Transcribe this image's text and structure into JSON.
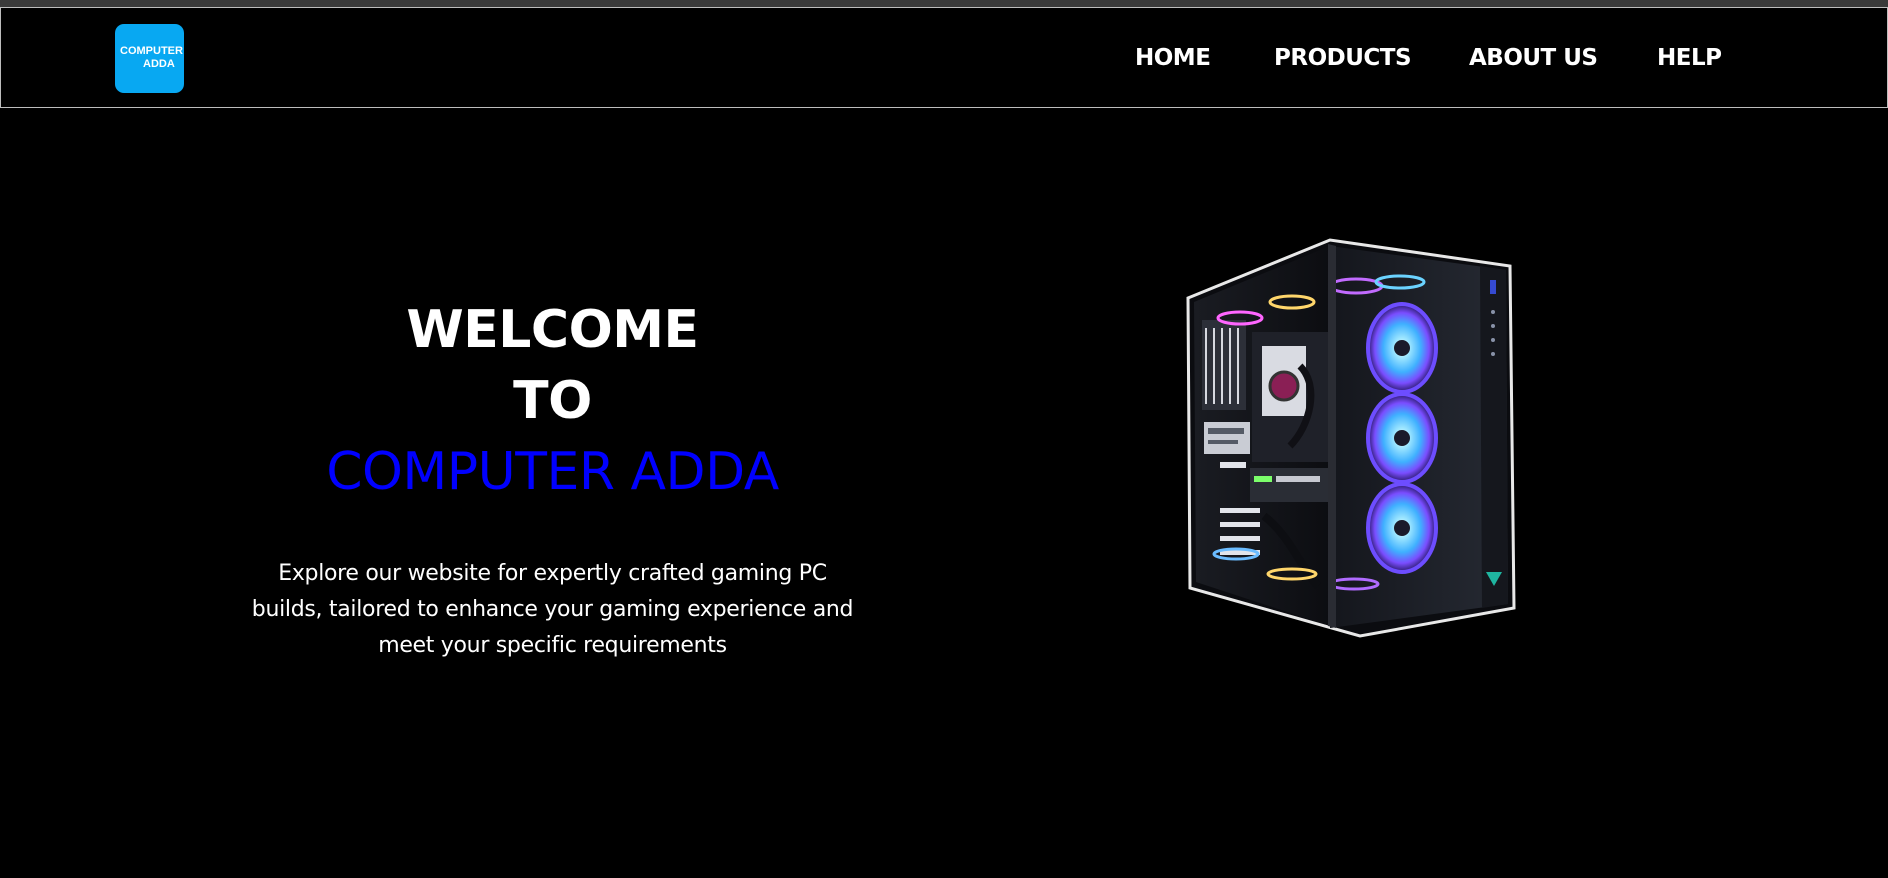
{
  "brand": {
    "logo_line1": "COMPUTER",
    "logo_line2": "ADDA",
    "logo_color": "#08a8f2"
  },
  "nav": {
    "items": [
      {
        "label": "HOME"
      },
      {
        "label": "PRODUCTS"
      },
      {
        "label": "ABOUT US"
      },
      {
        "label": "HELP"
      }
    ]
  },
  "hero": {
    "line1": "WELCOME",
    "line2": "TO",
    "brand_line": "COMPUTER ADDA",
    "brand_color": "#0000ff",
    "tagline_lines": [
      "Explore our website for expertly crafted gaming PC",
      "builds, tailored to enhance your gaming experience and",
      "meet your specific requirements"
    ]
  },
  "image": {
    "icon": "gaming-pc-case-image"
  },
  "colors": {
    "background": "#000000",
    "text": "#ffffff",
    "navbar_border": "#bdbdbd"
  }
}
